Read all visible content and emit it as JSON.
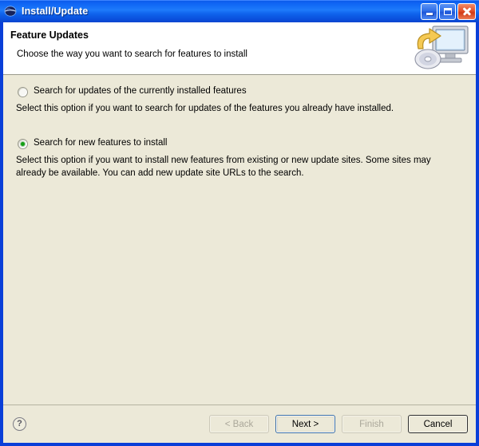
{
  "window": {
    "title": "Install/Update",
    "icon": "eclipse-globe-icon",
    "controls": {
      "minimize": "minimize-button",
      "maximize": "maximize-button",
      "close": "close-button"
    },
    "colors": {
      "titlebar_blue": "#1168f5",
      "frame_blue": "#0a3fd8",
      "dialog_bg": "#ece9d8",
      "banner_bg": "#ffffff",
      "radio_selected": "#14a014",
      "close_red": "#e2512a"
    }
  },
  "banner": {
    "title": "Feature Updates",
    "subtitle": "Choose the way you want to search for features to install",
    "icon": "computer-update-icon"
  },
  "content": {
    "options": [
      {
        "label": "Search for updates of the currently installed features",
        "description": "Select this option if you want to search for updates of the features you already have installed.",
        "selected": false
      },
      {
        "label": "Search for new features to install",
        "description": "Select this option if you want to install new features from existing or new update sites. Some sites may already be available. You can add new update site URLs to the search.",
        "selected": true
      }
    ]
  },
  "footer": {
    "help": "?",
    "buttons": [
      {
        "label": "< Back",
        "state": "disabled"
      },
      {
        "label": "Next >",
        "state": "default"
      },
      {
        "label": "Finish",
        "state": "disabled"
      },
      {
        "label": "Cancel",
        "state": "enabled"
      }
    ]
  }
}
